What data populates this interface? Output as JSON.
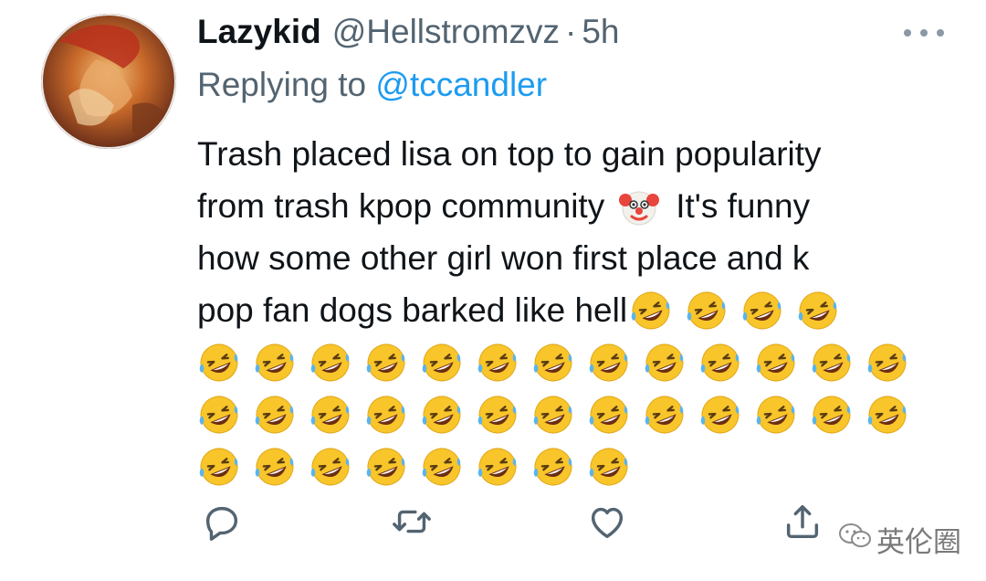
{
  "tweet": {
    "display_name": "Lazykid",
    "handle": "@Hellstromzvz",
    "separator": "·",
    "time": "5h",
    "replying_prefix": "Replying to ",
    "replying_to": "@tccandler",
    "lines": [
      "Trash placed lisa on top to gain popularity",
      "from trash kpop community",
      "It's funny",
      "how some other girl won first place and k",
      "pop fan dogs barked like hell"
    ],
    "emojis": {
      "clown": "clown-face-emoji",
      "laugh": "rolling-on-floor-laughing-emoji",
      "laugh_count_line4": 4,
      "laugh_rows": [
        13,
        13,
        8
      ]
    }
  },
  "actions": {
    "reply_icon": "reply-icon",
    "retweet_icon": "retweet-icon",
    "like_icon": "heart-icon",
    "share_icon": "share-icon",
    "more_icon": "more-options-icon"
  },
  "watermark": {
    "text": "英伦圈",
    "icon": "wechat-icon"
  },
  "colors": {
    "text": "#0f1419",
    "secondary": "#536471",
    "accent": "#1d9bf0",
    "icon": "#536471"
  }
}
